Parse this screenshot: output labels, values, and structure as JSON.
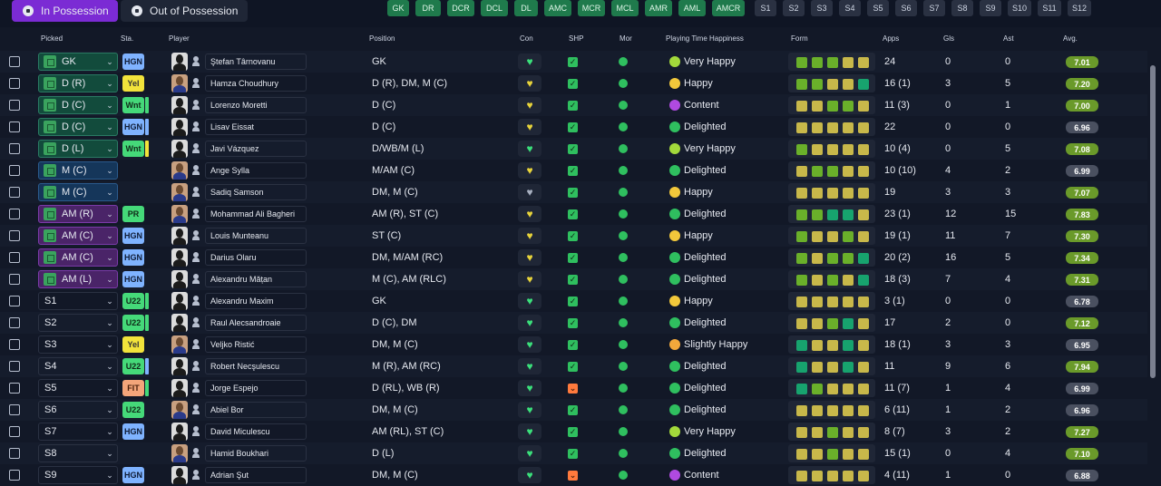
{
  "tabs": [
    {
      "label": "In Possession",
      "active": true
    },
    {
      "label": "Out of Possession",
      "active": false
    }
  ],
  "position_buttons": [
    {
      "label": "GK",
      "style": "green"
    },
    {
      "label": "DR",
      "style": "green"
    },
    {
      "label": "DCR",
      "style": "green"
    },
    {
      "label": "DCL",
      "style": "green"
    },
    {
      "label": "DL",
      "style": "green"
    },
    {
      "label": "AMC",
      "style": "green"
    },
    {
      "label": "MCR",
      "style": "green"
    },
    {
      "label": "MCL",
      "style": "green"
    },
    {
      "label": "AMR",
      "style": "green"
    },
    {
      "label": "AML",
      "style": "green"
    },
    {
      "label": "AMCR",
      "style": "green"
    },
    {
      "label": "S1",
      "style": "grey"
    },
    {
      "label": "S2",
      "style": "grey"
    },
    {
      "label": "S3",
      "style": "grey"
    },
    {
      "label": "S4",
      "style": "grey"
    },
    {
      "label": "S5",
      "style": "grey"
    },
    {
      "label": "S6",
      "style": "grey"
    },
    {
      "label": "S7",
      "style": "grey"
    },
    {
      "label": "S8",
      "style": "grey"
    },
    {
      "label": "S9",
      "style": "grey"
    },
    {
      "label": "S10",
      "style": "grey"
    },
    {
      "label": "S11",
      "style": "grey"
    },
    {
      "label": "S12",
      "style": "grey"
    }
  ],
  "columns": {
    "picked": "Picked",
    "sta": "Sta.",
    "player": "Player",
    "position": "Position",
    "con": "Con",
    "shp": "SHP",
    "mor": "Mor",
    "happiness": "Playing Time Happiness",
    "form": "Form",
    "apps": "Apps",
    "gls": "Gls",
    "ast": "Ast",
    "avg": "Avg."
  },
  "rows": [
    {
      "picked": "GK",
      "pick_style": "gk",
      "sta": "HGN",
      "sta_style": "hgn",
      "bar": "",
      "face": "silhouette",
      "name": "Ştefan Târnovanu",
      "position": "GK",
      "con": "green",
      "shp": "ok",
      "happiness": "Very Happy",
      "hap_style": "veryhappy",
      "form": [
        "g",
        "g",
        "g",
        "y",
        "y"
      ],
      "apps": "24",
      "gls": "0",
      "ast": "0",
      "avg": "7.01",
      "avg_style": "g"
    },
    {
      "picked": "D (R)",
      "pick_style": "def",
      "sta": "Yel",
      "sta_style": "yel",
      "bar": "",
      "face": "photo",
      "name": "Hamza Choudhury",
      "position": "D (R), DM, M (C)",
      "con": "yellow",
      "shp": "ok",
      "happiness": "Happy",
      "hap_style": "happy",
      "form": [
        "g",
        "g",
        "y",
        "y",
        "t"
      ],
      "apps": "16 (1)",
      "gls": "3",
      "ast": "5",
      "avg": "7.20",
      "avg_style": "g"
    },
    {
      "picked": "D (C)",
      "pick_style": "def",
      "sta": "Wnt",
      "sta_style": "wnt",
      "bar": "green",
      "face": "silhouette",
      "name": "Lorenzo Moretti",
      "position": "D (C)",
      "con": "yellow",
      "shp": "ok",
      "happiness": "Content",
      "hap_style": "content",
      "form": [
        "y",
        "y",
        "g",
        "g",
        "y"
      ],
      "apps": "11 (3)",
      "gls": "0",
      "ast": "1",
      "avg": "7.00",
      "avg_style": "g"
    },
    {
      "picked": "D (C)",
      "pick_style": "def",
      "sta": "HGN",
      "sta_style": "hgn",
      "bar": "hgn",
      "face": "silhouette",
      "name": "Lisav Eissat",
      "position": "D (C)",
      "con": "yellow",
      "shp": "ok",
      "happiness": "Delighted",
      "hap_style": "delighted",
      "form": [
        "y",
        "y",
        "y",
        "y",
        "y"
      ],
      "apps": "22",
      "gls": "0",
      "ast": "0",
      "avg": "6.96",
      "avg_style": "d"
    },
    {
      "picked": "D (L)",
      "pick_style": "def",
      "sta": "Wnt",
      "sta_style": "wnt",
      "bar": "yel",
      "face": "silhouette",
      "name": "Javi Vázquez",
      "position": "D/WB/M (L)",
      "con": "green",
      "shp": "ok",
      "happiness": "Very Happy",
      "hap_style": "veryhappy",
      "form": [
        "g",
        "y",
        "y",
        "y",
        "y"
      ],
      "apps": "10 (4)",
      "gls": "0",
      "ast": "5",
      "avg": "7.08",
      "avg_style": "g"
    },
    {
      "picked": "M (C)",
      "pick_style": "mid",
      "sta": "",
      "sta_style": "",
      "bar": "",
      "face": "photo",
      "name": "Ange Sylla",
      "position": "M/AM (C)",
      "con": "yellow",
      "shp": "ok",
      "happiness": "Delighted",
      "hap_style": "delighted",
      "form": [
        "y",
        "g",
        "g",
        "y",
        "y"
      ],
      "apps": "10 (10)",
      "gls": "4",
      "ast": "2",
      "avg": "6.99",
      "avg_style": "d"
    },
    {
      "picked": "M (C)",
      "pick_style": "mid",
      "sta": "",
      "sta_style": "",
      "bar": "",
      "face": "photo",
      "name": "Sadiq Samson",
      "position": "DM, M (C)",
      "con": "grey",
      "shp": "ok",
      "happiness": "Happy",
      "hap_style": "happy",
      "form": [
        "y",
        "y",
        "y",
        "y",
        "y"
      ],
      "apps": "19",
      "gls": "3",
      "ast": "3",
      "avg": "7.07",
      "avg_style": "g"
    },
    {
      "picked": "AM (R)",
      "pick_style": "att",
      "sta": "PR",
      "sta_style": "pr",
      "bar": "",
      "face": "photo",
      "name": "Mohammad Ali Bagheri",
      "position": "AM (R), ST (C)",
      "con": "yellow",
      "shp": "ok",
      "happiness": "Delighted",
      "hap_style": "delighted",
      "form": [
        "g",
        "g",
        "t",
        "t",
        "y"
      ],
      "apps": "23 (1)",
      "gls": "12",
      "ast": "15",
      "avg": "7.83",
      "avg_style": "g"
    },
    {
      "picked": "AM (C)",
      "pick_style": "att",
      "sta": "HGN",
      "sta_style": "hgn",
      "bar": "",
      "face": "silhouette",
      "name": "Louis Munteanu",
      "position": "ST (C)",
      "con": "yellow",
      "shp": "ok",
      "happiness": "Happy",
      "hap_style": "happy",
      "form": [
        "g",
        "y",
        "y",
        "g",
        "y"
      ],
      "apps": "19 (1)",
      "gls": "11",
      "ast": "7",
      "avg": "7.30",
      "avg_style": "g"
    },
    {
      "picked": "AM (C)",
      "pick_style": "att",
      "sta": "HGN",
      "sta_style": "hgn",
      "bar": "",
      "face": "silhouette",
      "name": "Darius Olaru",
      "position": "DM, M/AM (RC)",
      "con": "yellow",
      "shp": "ok",
      "happiness": "Delighted",
      "hap_style": "delighted",
      "form": [
        "g",
        "y",
        "g",
        "g",
        "t"
      ],
      "apps": "20 (2)",
      "gls": "16",
      "ast": "5",
      "avg": "7.34",
      "avg_style": "g"
    },
    {
      "picked": "AM (L)",
      "pick_style": "att",
      "sta": "HGN",
      "sta_style": "hgn",
      "bar": "",
      "face": "silhouette",
      "name": "Alexandru Mățan",
      "position": "M (C), AM (RLC)",
      "con": "yellow",
      "shp": "ok",
      "happiness": "Delighted",
      "hap_style": "delighted",
      "form": [
        "g",
        "y",
        "g",
        "y",
        "t"
      ],
      "apps": "18 (3)",
      "gls": "7",
      "ast": "4",
      "avg": "7.31",
      "avg_style": "g"
    },
    {
      "picked": "S1",
      "pick_style": "sub",
      "sta": "U22",
      "sta_style": "u22",
      "bar": "green",
      "face": "silhouette",
      "name": "Alexandru Maxim",
      "position": "GK",
      "con": "green",
      "shp": "ok",
      "happiness": "Happy",
      "hap_style": "happy",
      "form": [
        "y",
        "y",
        "y",
        "y",
        "y"
      ],
      "apps": "3 (1)",
      "gls": "0",
      "ast": "0",
      "avg": "6.78",
      "avg_style": "d"
    },
    {
      "picked": "S2",
      "pick_style": "sub",
      "sta": "U22",
      "sta_style": "u22",
      "bar": "green",
      "face": "silhouette",
      "name": "Raul Alecsandroaie",
      "position": "D (C), DM",
      "con": "green",
      "shp": "ok",
      "happiness": "Delighted",
      "hap_style": "delighted",
      "form": [
        "y",
        "y",
        "g",
        "t",
        "y"
      ],
      "apps": "17",
      "gls": "2",
      "ast": "0",
      "avg": "7.12",
      "avg_style": "g"
    },
    {
      "picked": "S3",
      "pick_style": "sub",
      "sta": "Yel",
      "sta_style": "yel",
      "bar": "",
      "face": "photo",
      "name": "Veljko Ristić",
      "position": "DM, M (C)",
      "con": "green",
      "shp": "ok",
      "happiness": "Slightly Happy",
      "hap_style": "slightly",
      "form": [
        "t",
        "y",
        "y",
        "t",
        "y"
      ],
      "apps": "18 (1)",
      "gls": "3",
      "ast": "3",
      "avg": "6.95",
      "avg_style": "d"
    },
    {
      "picked": "S4",
      "pick_style": "sub",
      "sta": "U22",
      "sta_style": "u22",
      "bar": "hgn",
      "face": "silhouette",
      "name": "Robert Necşulescu",
      "position": "M (R), AM (RC)",
      "con": "green",
      "shp": "ok",
      "happiness": "Delighted",
      "hap_style": "delighted",
      "form": [
        "t",
        "y",
        "y",
        "t",
        "y"
      ],
      "apps": "11",
      "gls": "9",
      "ast": "6",
      "avg": "7.94",
      "avg_style": "g"
    },
    {
      "picked": "S5",
      "pick_style": "sub",
      "sta": "FIT",
      "sta_style": "fit",
      "bar": "green",
      "face": "silhouette",
      "name": "Jorge Espejo",
      "position": "D (RL), WB (R)",
      "con": "green",
      "shp": "bad",
      "happiness": "Delighted",
      "hap_style": "delighted",
      "form": [
        "t",
        "g",
        "y",
        "y",
        "y"
      ],
      "apps": "11 (7)",
      "gls": "1",
      "ast": "4",
      "avg": "6.99",
      "avg_style": "d"
    },
    {
      "picked": "S6",
      "pick_style": "sub",
      "sta": "U22",
      "sta_style": "u22",
      "bar": "",
      "face": "photo",
      "name": "Abiel Bor",
      "position": "DM, M (C)",
      "con": "green",
      "shp": "ok",
      "happiness": "Delighted",
      "hap_style": "delighted",
      "form": [
        "y",
        "y",
        "y",
        "y",
        "y"
      ],
      "apps": "6 (11)",
      "gls": "1",
      "ast": "2",
      "avg": "6.96",
      "avg_style": "d"
    },
    {
      "picked": "S7",
      "pick_style": "sub",
      "sta": "HGN",
      "sta_style": "hgn",
      "bar": "",
      "face": "silhouette",
      "name": "David Miculescu",
      "position": "AM (RL), ST (C)",
      "con": "green",
      "shp": "ok",
      "happiness": "Very Happy",
      "hap_style": "veryhappy",
      "form": [
        "y",
        "y",
        "g",
        "y",
        "y"
      ],
      "apps": "8 (7)",
      "gls": "3",
      "ast": "2",
      "avg": "7.27",
      "avg_style": "g"
    },
    {
      "picked": "S8",
      "pick_style": "sub",
      "sta": "",
      "sta_style": "",
      "bar": "",
      "face": "photo",
      "name": "Hamid Boukhari",
      "position": "D (L)",
      "con": "green",
      "shp": "ok",
      "happiness": "Delighted",
      "hap_style": "delighted",
      "form": [
        "y",
        "y",
        "g",
        "y",
        "y"
      ],
      "apps": "15 (1)",
      "gls": "0",
      "ast": "4",
      "avg": "7.10",
      "avg_style": "g"
    },
    {
      "picked": "S9",
      "pick_style": "sub",
      "sta": "HGN",
      "sta_style": "hgn",
      "bar": "",
      "face": "silhouette",
      "name": "Adrian Şut",
      "position": "DM, M (C)",
      "con": "green",
      "shp": "bad",
      "happiness": "Content",
      "hap_style": "content",
      "form": [
        "y",
        "y",
        "y",
        "y",
        "y"
      ],
      "apps": "4 (11)",
      "gls": "1",
      "ast": "0",
      "avg": "6.88",
      "avg_style": "d"
    }
  ]
}
